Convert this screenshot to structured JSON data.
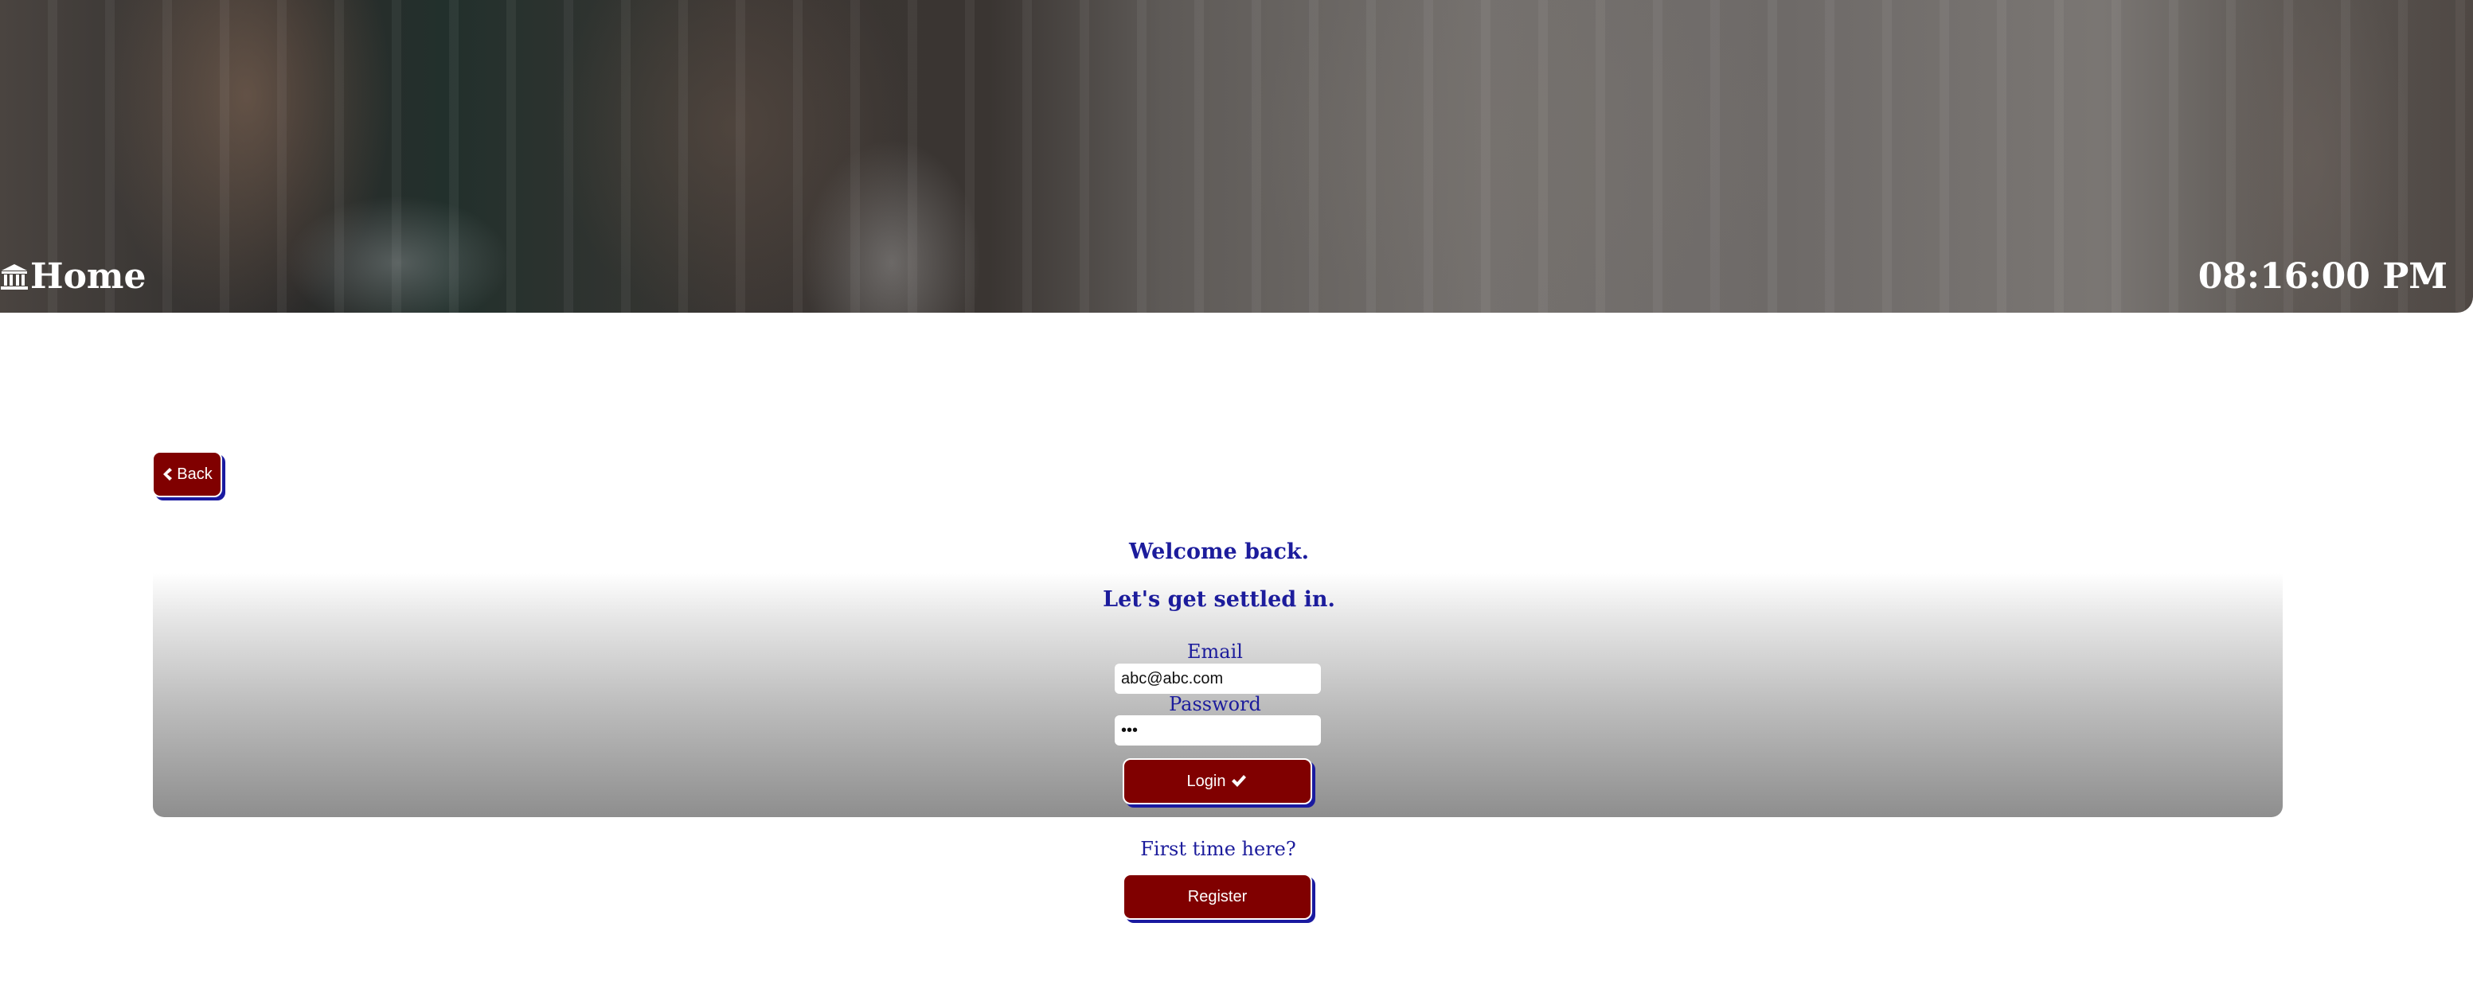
{
  "header": {
    "home_label": "Home",
    "home_icon": "bank-icon",
    "clock": "08:16:00 PM"
  },
  "nav": {
    "back_label": "Back",
    "back_icon": "chevron-left-icon"
  },
  "login": {
    "welcome": "Welcome back.",
    "subtitle": "Let's get settled in.",
    "email_label": "Email",
    "email_value": "abc@abc.com",
    "password_label": "Password",
    "password_value": "abc",
    "login_label": "Login",
    "login_icon": "check-icon"
  },
  "register": {
    "prompt": "First time here?",
    "button_label": "Register"
  },
  "colors": {
    "button": "#800000",
    "button_shadow": "#1a1aa0",
    "text_accent": "#1c1c9c"
  }
}
